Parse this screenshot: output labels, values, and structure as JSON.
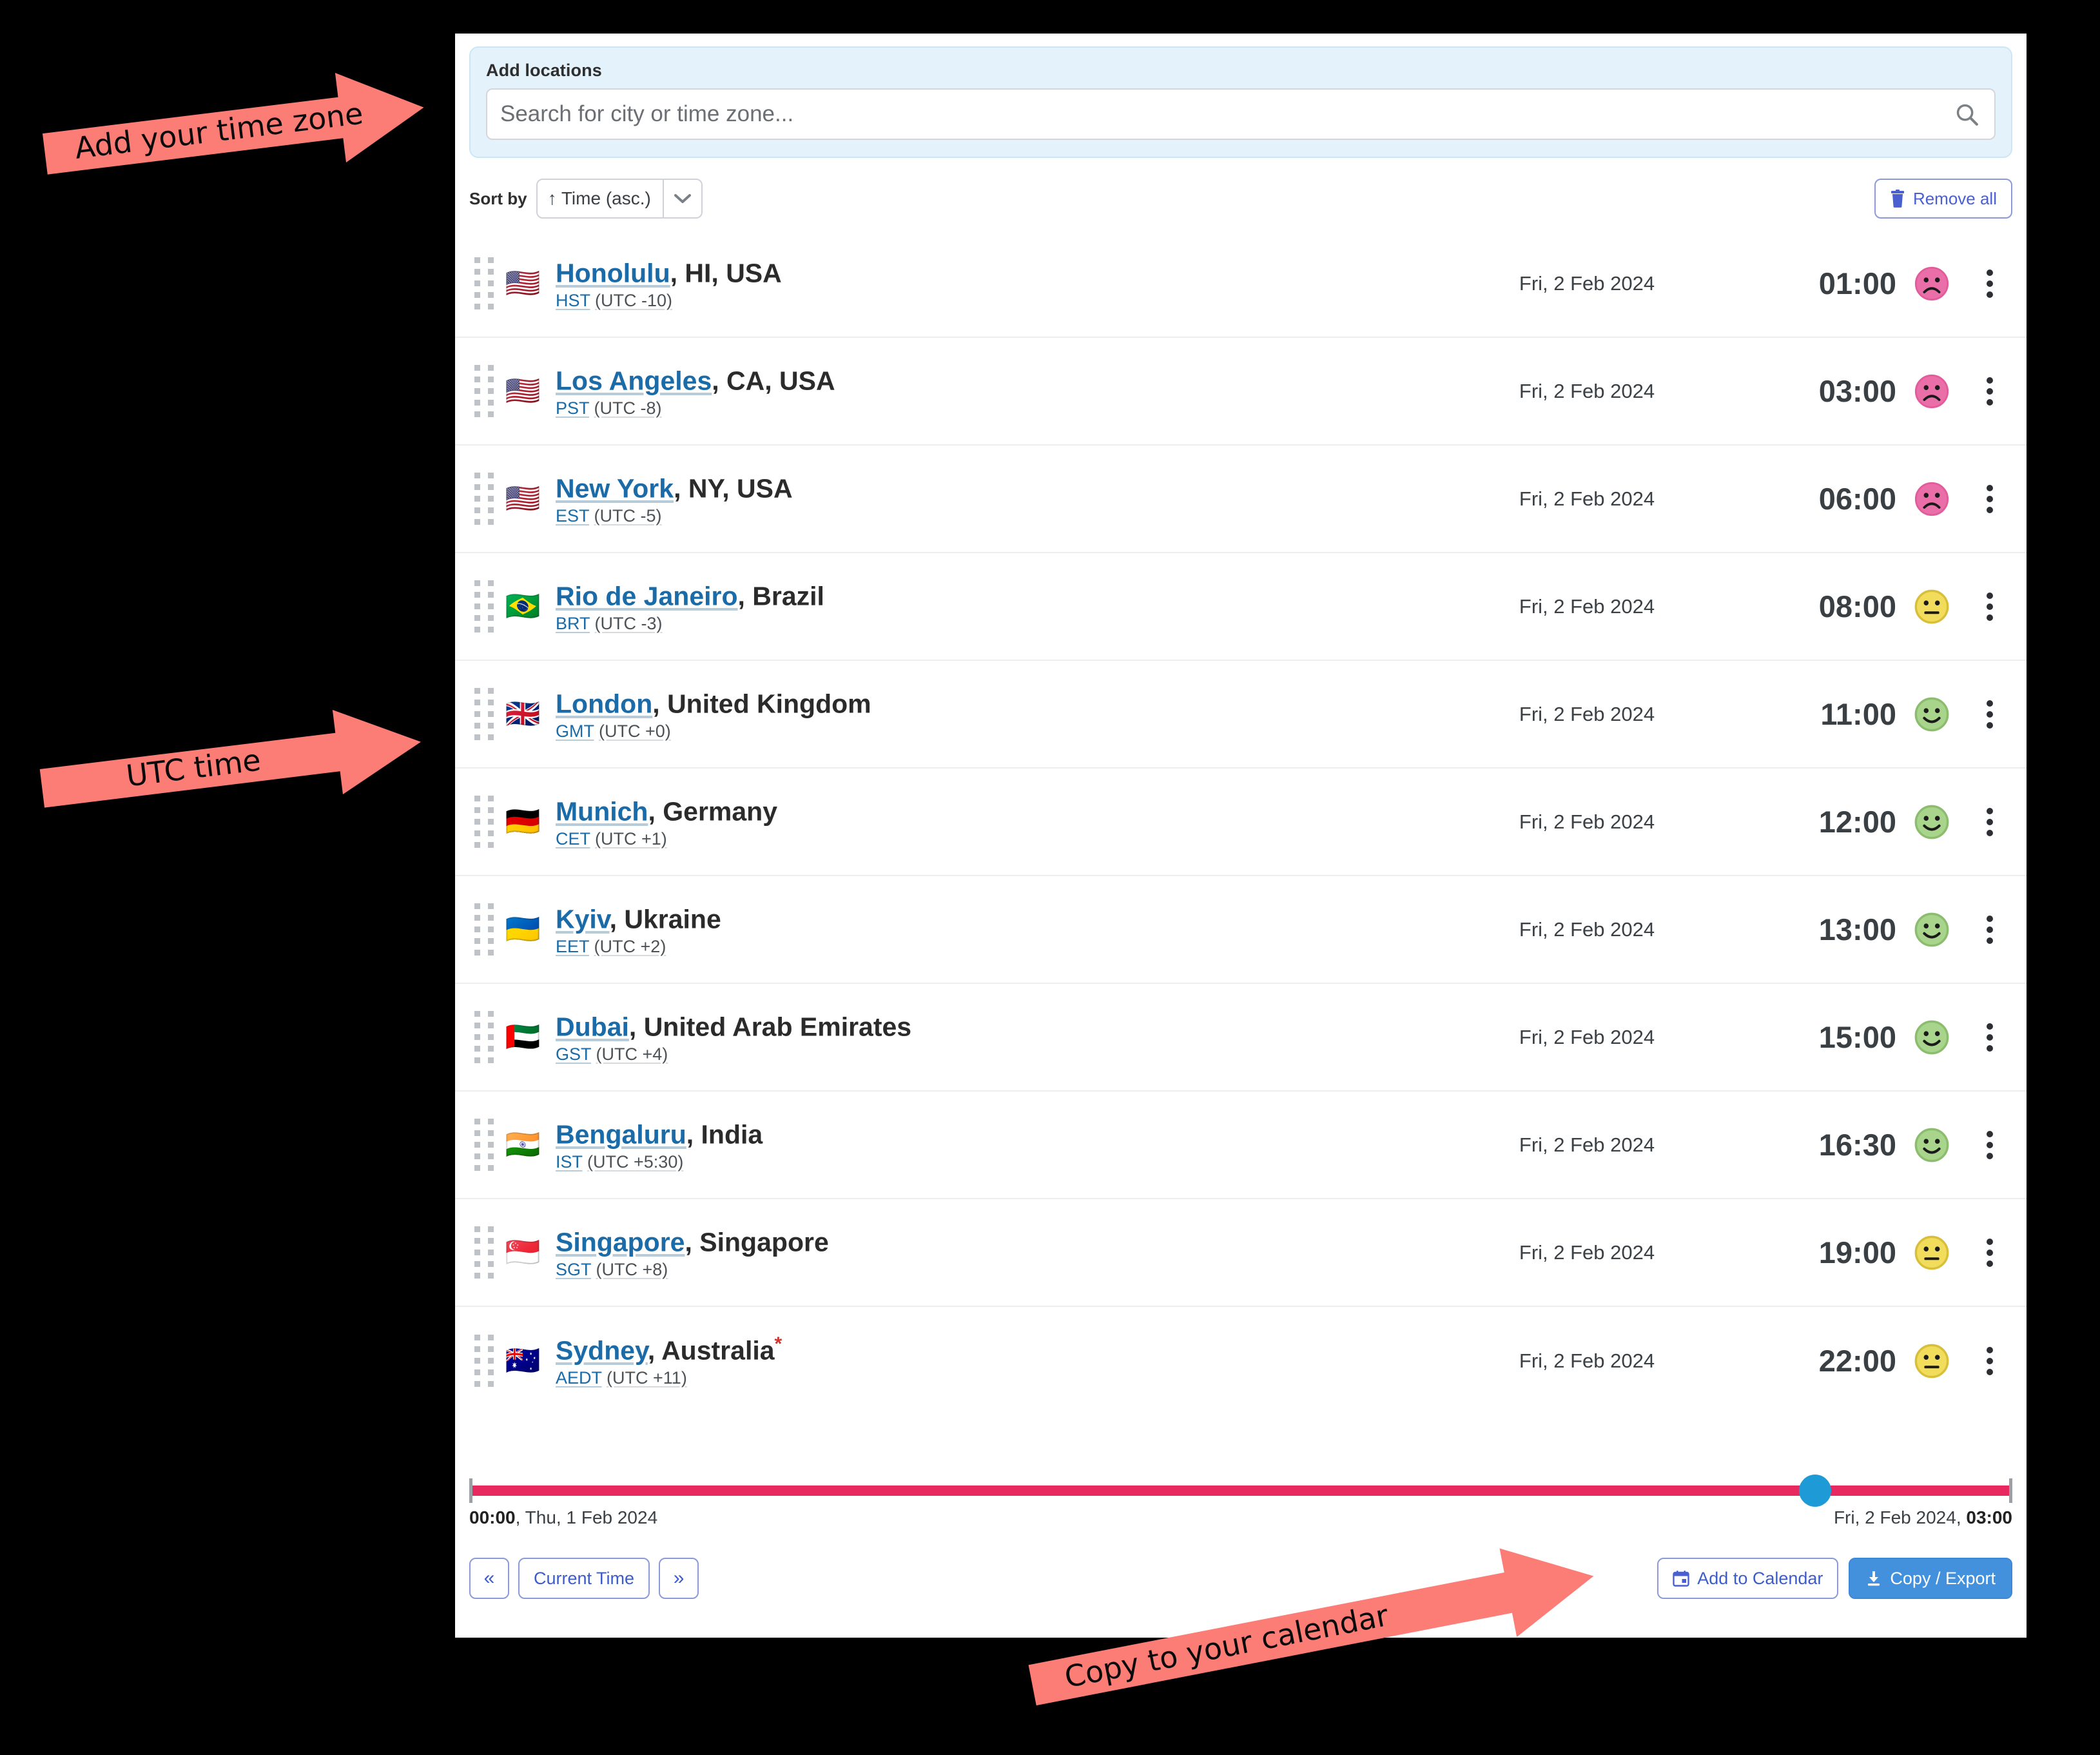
{
  "add_locations": {
    "label": "Add locations",
    "search_placeholder": "Search for city or time zone...",
    "search_value": "",
    "search_icon": "search-icon"
  },
  "toolbar": {
    "sort_by_label": "Sort by",
    "sort_value": "↑ Time (asc.)",
    "sort_options": [
      "↑ Time (asc.)"
    ],
    "remove_all_label": "Remove all",
    "remove_all_icon": "trash-icon"
  },
  "locations": [
    {
      "flag": "🇺🇸",
      "flag_name": "flag-usa",
      "city": "Honolulu",
      "region": ", HI, USA",
      "star": "",
      "abbr": "HST",
      "utc": "(UTC -10)",
      "date": "Fri, 2 Feb 2024",
      "time": "01:00",
      "mood": "sad"
    },
    {
      "flag": "🇺🇸",
      "flag_name": "flag-usa",
      "city": "Los Angeles",
      "region": ", CA, USA",
      "star": "",
      "abbr": "PST",
      "utc": "(UTC -8)",
      "date": "Fri, 2 Feb 2024",
      "time": "03:00",
      "mood": "sad"
    },
    {
      "flag": "🇺🇸",
      "flag_name": "flag-usa",
      "city": "New York",
      "region": ", NY, USA",
      "star": "",
      "abbr": "EST",
      "utc": "(UTC -5)",
      "date": "Fri, 2 Feb 2024",
      "time": "06:00",
      "mood": "sad"
    },
    {
      "flag": "🇧🇷",
      "flag_name": "flag-brazil",
      "city": "Rio de Janeiro",
      "region": ", Brazil",
      "star": "",
      "abbr": "BRT",
      "utc": "(UTC -3)",
      "date": "Fri, 2 Feb 2024",
      "time": "08:00",
      "mood": "neutral"
    },
    {
      "flag": "🇬🇧",
      "flag_name": "flag-united-kingdom",
      "city": "London",
      "region": ", United Kingdom",
      "star": "",
      "abbr": "GMT",
      "utc": "(UTC +0)",
      "date": "Fri, 2 Feb 2024",
      "time": "11:00",
      "mood": "happy"
    },
    {
      "flag": "🇩🇪",
      "flag_name": "flag-germany",
      "city": "Munich",
      "region": ", Germany",
      "star": "",
      "abbr": "CET",
      "utc": "(UTC +1)",
      "date": "Fri, 2 Feb 2024",
      "time": "12:00",
      "mood": "happy"
    },
    {
      "flag": "🇺🇦",
      "flag_name": "flag-ukraine",
      "city": "Kyiv",
      "region": ", Ukraine",
      "star": "",
      "abbr": "EET",
      "utc": "(UTC +2)",
      "date": "Fri, 2 Feb 2024",
      "time": "13:00",
      "mood": "happy"
    },
    {
      "flag": "🇦🇪",
      "flag_name": "flag-united-arab-emirates",
      "city": "Dubai",
      "region": ", United Arab Emirates",
      "star": "",
      "abbr": "GST",
      "utc": "(UTC +4)",
      "date": "Fri, 2 Feb 2024",
      "time": "15:00",
      "mood": "happy"
    },
    {
      "flag": "🇮🇳",
      "flag_name": "flag-india",
      "city": "Bengaluru",
      "region": ", India",
      "star": "",
      "abbr": "IST",
      "utc": "(UTC +5:30)",
      "date": "Fri, 2 Feb 2024",
      "time": "16:30",
      "mood": "happy"
    },
    {
      "flag": "🇸🇬",
      "flag_name": "flag-singapore",
      "city": "Singapore",
      "region": ", Singapore",
      "star": "",
      "abbr": "SGT",
      "utc": "(UTC +8)",
      "date": "Fri, 2 Feb 2024",
      "time": "19:00",
      "mood": "neutral"
    },
    {
      "flag": "🇦🇺",
      "flag_name": "flag-australia",
      "city": "Sydney",
      "region": ", Australia",
      "star": "*",
      "abbr": "AEDT",
      "utc": "(UTC +11)",
      "date": "Fri, 2 Feb 2024",
      "time": "22:00",
      "mood": "neutral"
    }
  ],
  "timeline": {
    "start_time": "00:00",
    "start_date": ", Thu, 1 Feb 2024",
    "end_date": "Fri, 2 Feb 2024, ",
    "end_time": "03:00",
    "handle_position_percent": 87.2
  },
  "footer": {
    "prev_label": "«",
    "current_time_label": "Current Time",
    "next_label": "»",
    "add_to_calendar_label": "Add to Calendar",
    "add_to_calendar_icon": "calendar-icon",
    "copy_export_label": "Copy / Export",
    "copy_export_icon": "download-icon"
  },
  "annotations": [
    {
      "text": "Add your time zone",
      "name": "annotation-add-your-time-zone"
    },
    {
      "text": "UTC time",
      "name": "annotation-utc-time"
    },
    {
      "text": "Copy to your calendar",
      "name": "annotation-copy-to-your-calendar"
    }
  ],
  "colors": {
    "accent_blue": "#1a6ba8",
    "link_blue": "#3d5ccc",
    "primary_button": "#4391dd",
    "timeline_track": "#e7295f",
    "timeline_handle": "#1e9ad6",
    "annotation_arrow": "#fc7c76",
    "mood_sad": "#e86aa6",
    "mood_neutral": "#e8cf52",
    "mood_happy": "#9dcc83",
    "addbox_bg": "#e4f2fb"
  }
}
